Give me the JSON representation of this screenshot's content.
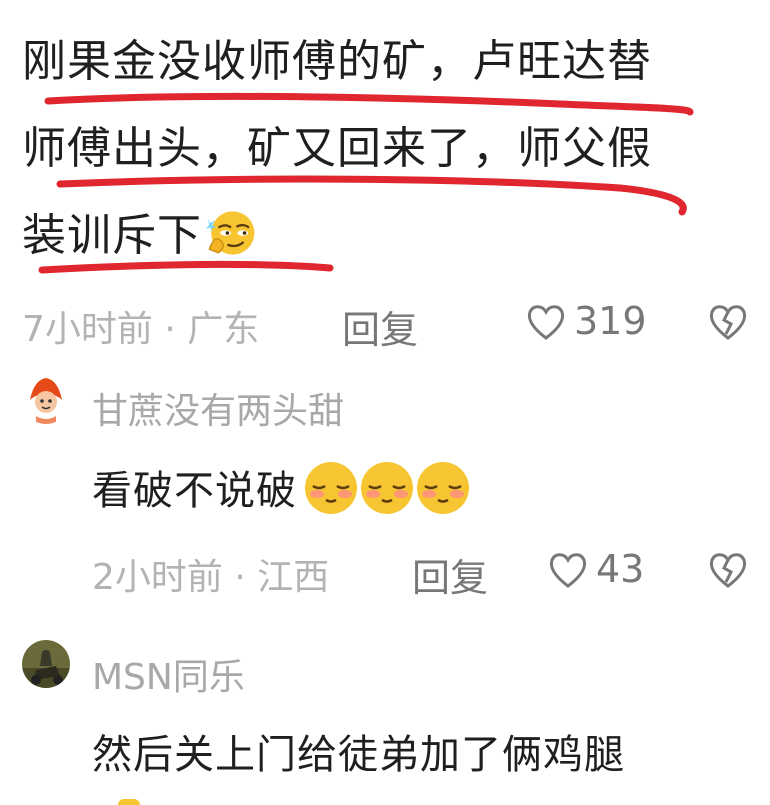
{
  "main_comment": {
    "line1": "刚果金没收师傅的矿，卢旺达替",
    "line2": "师傅出头，矿又回来了，师父假",
    "line3": "装训斥下",
    "inline_emoji": "smirk-emoji",
    "time": "7小时前",
    "location": "广东",
    "reply_label": "回复",
    "likes": "319",
    "underline_color": "#e0262f"
  },
  "replies": [
    {
      "username": "甘蔗没有两头甜",
      "text": "看破不说破",
      "emojis": [
        "shy-emoji",
        "shy-emoji",
        "shy-emoji"
      ],
      "time": "2小时前",
      "location": "江西",
      "reply_label": "回复",
      "likes": "43"
    },
    {
      "username": "MSN同乐",
      "text": "然后关上门给徒弟加了俩鸡腿"
    }
  ],
  "separator": "·"
}
